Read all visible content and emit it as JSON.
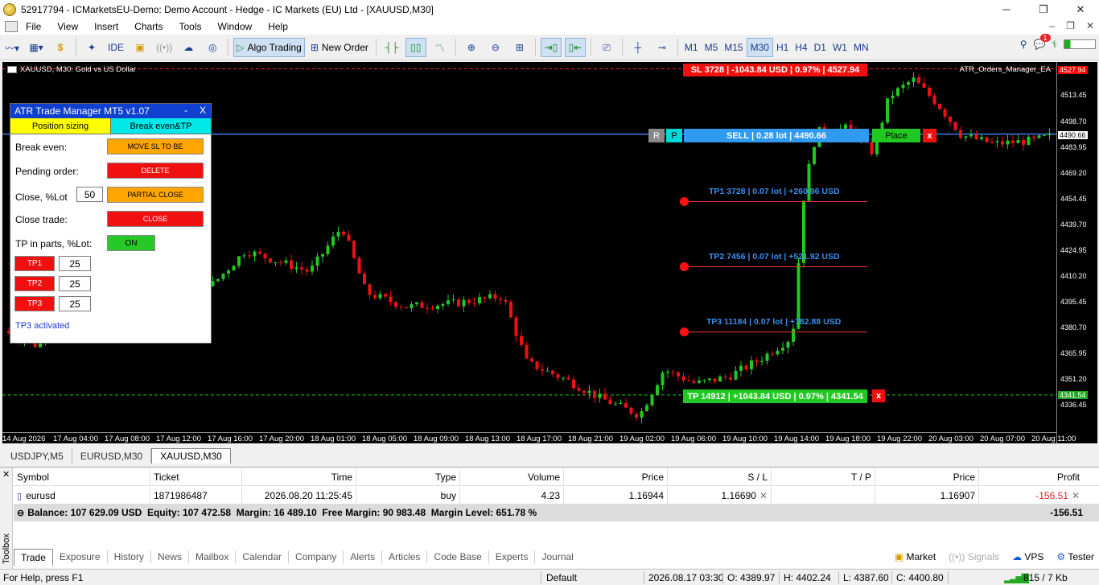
{
  "window": {
    "title": "52917794 - ICMarketsEU-Demo: Demo Account - Hedge - IC Markets (EU) Ltd - [XAUUSD,M30]",
    "min": "─",
    "max": "❐",
    "close": "✕"
  },
  "menu": {
    "items": [
      "File",
      "View",
      "Insert",
      "Charts",
      "Tools",
      "Window",
      "Help"
    ],
    "right": [
      "–",
      "❐",
      "✕"
    ]
  },
  "toolbar": {
    "ide": "IDE",
    "algo": "Algo Trading",
    "new_order": "New Order",
    "timeframes": [
      "M1",
      "M5",
      "M15",
      "M30",
      "H1",
      "H4",
      "D1",
      "W1",
      "MN"
    ],
    "active_tf": "M30",
    "notif_count": "1"
  },
  "chart": {
    "symbol_label": "XAUUSD, M30:  Gold vs US Dollar",
    "ea_label": "ATR_Orders_Manager_EA",
    "y_ticks": [
      "4513.45",
      "4498.70",
      "4483.95",
      "4469.20",
      "4454.45",
      "4439.70",
      "4424.95",
      "4410.20",
      "4395.45",
      "4380.70",
      "4365.95",
      "4351.20",
      "4336.45"
    ],
    "price_sl": "4527.94",
    "price_current": "4490.66",
    "price_tp": "4341.54",
    "x_ticks": [
      "14 Aug 2026",
      "17 Aug 04:00",
      "17 Aug 08:00",
      "17 Aug 12:00",
      "17 Aug 16:00",
      "17 Aug 20:00",
      "18 Aug 01:00",
      "18 Aug 05:00",
      "18 Aug 09:00",
      "18 Aug 13:00",
      "18 Aug 17:00",
      "18 Aug 21:00",
      "19 Aug 02:00",
      "19 Aug 06:00",
      "19 Aug 10:00",
      "19 Aug 14:00",
      "19 Aug 18:00",
      "19 Aug 22:00",
      "20 Aug 03:00",
      "20 Aug 07:00",
      "20 Aug 11:00"
    ],
    "sl_tag": "SL 3728 | -1043.84 USD | 0.97% | 4527.94",
    "r_btn": "R",
    "p_btn": "P",
    "sell_tag": "SELL | 0.28 lot | 4490.66",
    "place_btn": "Place",
    "x_btn": "x",
    "tp1": "TP1 3728 | 0.07 lot | +260.96 USD",
    "tp2": "TP2 7456 | 0.07 lot | +521.92 USD",
    "tp3": "TP3 11184 | 0.07 lot | +782.88 USD",
    "tp_tag": "TP 14912 | +1043.84 USD | 0.97% | 4341.54"
  },
  "panel": {
    "title": "ATR Trade Manager MT5 v1.07",
    "min": "-",
    "close": "X",
    "tab1": "Position sizing",
    "tab2": "Break even&TP",
    "break_even_label": "Break even:",
    "move_sl_btn": "MOVE SL TO BE",
    "pending_label": "Pending order:",
    "delete_btn": "DELETE",
    "close_pct_label": "Close, %Lot",
    "close_pct_value": "50",
    "partial_btn": "PARTIAL CLOSE",
    "close_trade_label": "Close trade:",
    "close_btn": "CLOSE",
    "tp_parts_label": "TP in parts, %Lot:",
    "on_btn": "ON",
    "tp1_btn": "TP1",
    "tp1_value": "25",
    "tp2_btn": "TP2",
    "tp2_value": "25",
    "tp3_btn": "TP3",
    "tp3_value": "25",
    "status": "TP3 activated"
  },
  "chart_tabs": [
    "USDJPY,M5",
    "EURUSD,M30",
    "XAUUSD,M30"
  ],
  "active_chart_tab": "XAUUSD,M30",
  "terminal": {
    "toolbox": "Toolbox",
    "headers": [
      "Symbol",
      "Ticket",
      "Time",
      "Type",
      "Volume",
      "Price",
      "S / L",
      "T / P",
      "Price",
      "Profit"
    ],
    "row": {
      "symbol": "eurusd",
      "ticket": "1871986487",
      "time": "2026.08.20 11:25:45",
      "type": "buy",
      "volume": "4.23",
      "price": "1.16944",
      "sl": "1.16690",
      "tp": "",
      "cur_price": "1.16907",
      "profit": "-156.51"
    },
    "summary": "Balance: 107 629.09 USD  Equity: 107 472.58  Margin: 16 489.10  Free Margin: 90 983.48  Margin Level: 651.78 %",
    "summary_profit": "-156.51",
    "tabs": [
      "Trade",
      "Exposure",
      "History",
      "News",
      "Mailbox",
      "Calendar",
      "Company",
      "Alerts",
      "Articles",
      "Code Base",
      "Experts",
      "Journal"
    ],
    "active_tab": "Trade",
    "right": [
      "Market",
      "Signals",
      "VPS",
      "Tester"
    ]
  },
  "statusbar": {
    "help": "For Help, press F1",
    "profile": "Default",
    "datetime": "2026.08.17 03:30",
    "open": "O: 4389.97",
    "high": "H: 4402.24",
    "low": "L: 4387.60",
    "close": "C: 4400.80",
    "traffic": "815 / 7 Kb"
  }
}
